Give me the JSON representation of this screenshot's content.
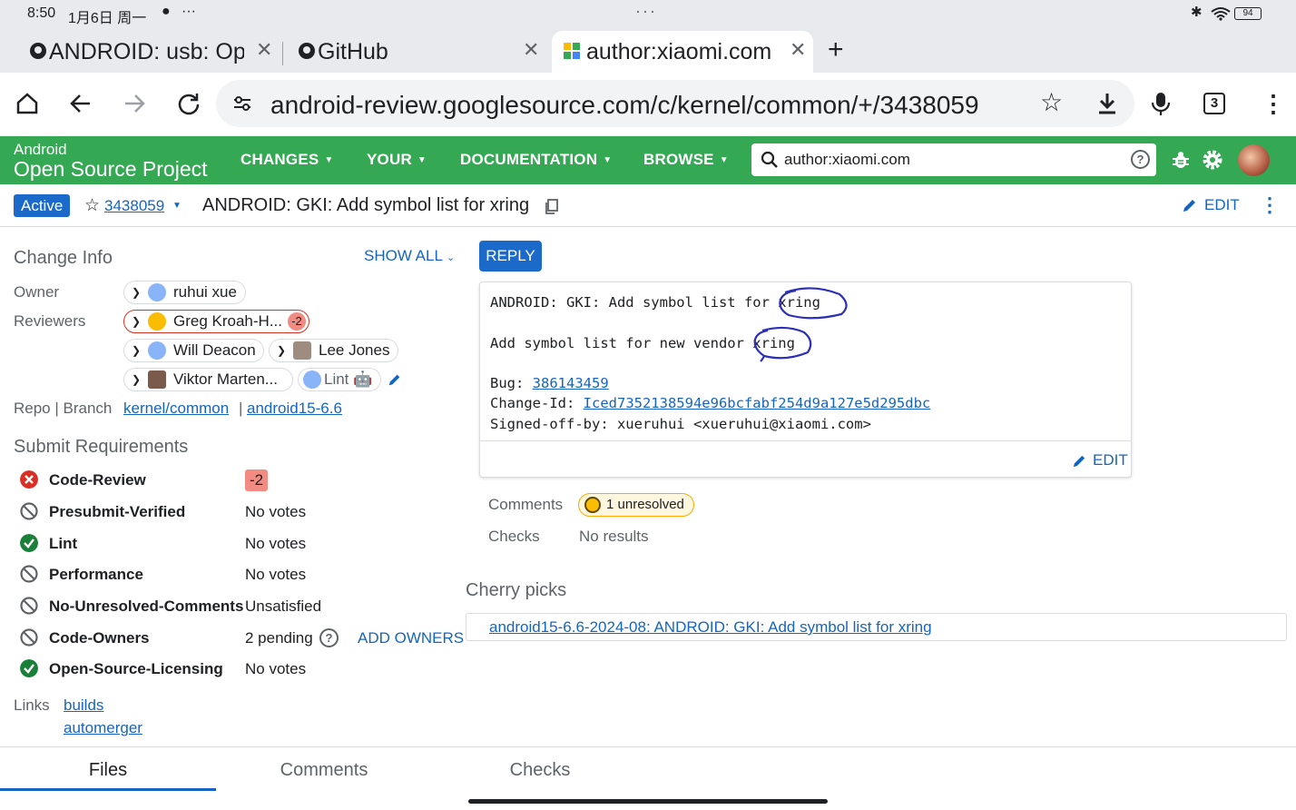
{
  "status_bar": {
    "time": "8:50",
    "date": "1月6日 周一",
    "more": "···",
    "battery": "94"
  },
  "tabs": [
    {
      "label": "ANDROID: usb: Op"
    },
    {
      "label": "GitHub"
    },
    {
      "label": "author:xiaomi.com"
    }
  ],
  "toolbar": {
    "url": "android-review.googlesource.com/c/kernel/common/+/3438059",
    "tab_count": "3"
  },
  "gerrit_header": {
    "logo_top": "Android",
    "logo_bottom": "Open Source Project",
    "menus": [
      "CHANGES",
      "YOUR",
      "DOCUMENTATION",
      "BROWSE"
    ],
    "search_value": "author:xiaomi.com"
  },
  "change_header": {
    "status": "Active",
    "change_number": "3438059",
    "subject": "ANDROID: GKI: Add symbol list for xring",
    "edit_label": "EDIT"
  },
  "change_info": {
    "title": "Change Info",
    "show_all": "SHOW ALL",
    "owner_label": "Owner",
    "owner": "ruhui xue",
    "reviewers_label": "Reviewers",
    "reviewers": [
      {
        "name": "Greg Kroah-H...",
        "vote": "-2"
      },
      {
        "name": "Will Deacon"
      },
      {
        "name": "Lee Jones"
      },
      {
        "name": "Viktor Marten..."
      },
      {
        "name": "Lint 🤖"
      }
    ],
    "repo_label": "Repo | Branch",
    "repo": "kernel/common",
    "separator": "|",
    "branch": "android15-6.6"
  },
  "submit_requirements": {
    "title": "Submit Requirements",
    "items": [
      {
        "name": "Code-Review",
        "value": "-2",
        "status": "blocked"
      },
      {
        "name": "Presubmit-Verified",
        "value": "No votes",
        "status": "unsatisfied"
      },
      {
        "name": "Lint",
        "value": "No votes",
        "status": "satisfied"
      },
      {
        "name": "Performance",
        "value": "No votes",
        "status": "unsatisfied"
      },
      {
        "name": "No-Unresolved-Comments",
        "value": "Unsatisfied",
        "status": "unsatisfied"
      },
      {
        "name": "Code-Owners",
        "value": "2 pending",
        "status": "unsatisfied"
      },
      {
        "name": "Open-Source-Licensing",
        "value": "No votes",
        "status": "satisfied"
      }
    ],
    "add_owners": "ADD OWNERS"
  },
  "links": {
    "label": "Links",
    "items": [
      "builds",
      "automerger"
    ]
  },
  "commit_message": {
    "reply": "REPLY",
    "line1": "ANDROID: GKI: Add symbol list for ",
    "line1_hl": "xring",
    "line2": "Add symbol list for new vendor ",
    "line2_hl": "xring",
    "bug_label": "Bug: ",
    "bug": "386143459",
    "changeid_label": "Change-Id: ",
    "changeid": "Iced7352138594e96bcfabf254d9a127e5d295dbc",
    "signed": "Signed-off-by: xueruhui <xueruhui@xiaomi.com>",
    "edit_label": "EDIT"
  },
  "summary": {
    "comments_label": "Comments",
    "unresolved": "1 unresolved",
    "checks_label": "Checks",
    "checks_value": "No results"
  },
  "cherry_picks": {
    "title": "Cherry picks",
    "item": "android15-6.6-2024-08: ANDROID: GKI: Add symbol list for xring"
  },
  "bottom_tabs": [
    "Files",
    "Comments",
    "Checks"
  ],
  "colors": {
    "gerrit_green": "#34a853",
    "link": "#1565c0",
    "active_badge": "#1b6ac9",
    "reply_button": "#1b6ac9",
    "annotation_ink": "#2c2fb8"
  }
}
